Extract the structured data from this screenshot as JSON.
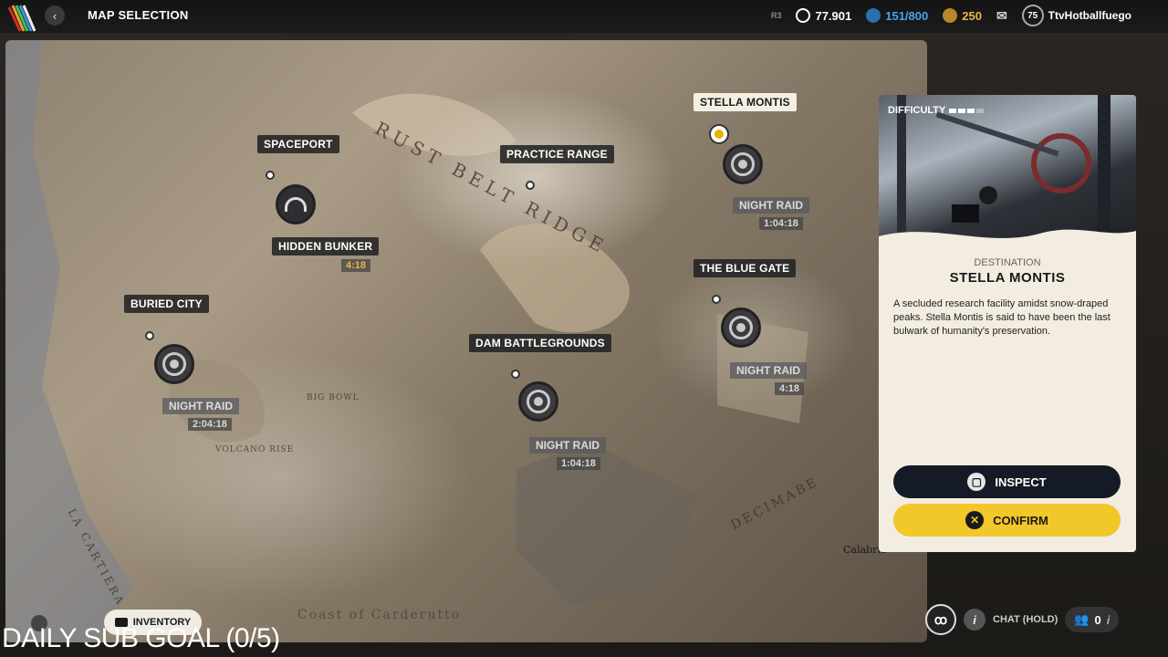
{
  "topbar": {
    "title": "MAP SELECTION",
    "back_icon": "chevron-left-icon",
    "currencies": [
      {
        "icon": "coin-icon",
        "value": "77.901",
        "color": "#ffffff"
      },
      {
        "icon": "token-icon",
        "value": "151/800",
        "color": "#4aa3e8"
      },
      {
        "icon": "gold-icon",
        "value": "250",
        "color": "#e8b64a"
      }
    ],
    "small_tag": "R3",
    "mail_icon": "mail-icon",
    "level": "75",
    "username": "TtvHotballfuego"
  },
  "map": {
    "regions": [
      "RUST BELT RIDGE",
      "DECIMABE",
      "LA CARTIERA"
    ],
    "minor_labels": [
      "BIG BOWL",
      "VOLCANO RISE",
      "Coast of Carderutto",
      "Calabria"
    ],
    "locations": [
      {
        "name": "SPACEPORT"
      },
      {
        "name": "HIDDEN BUNKER",
        "timer": "4:18"
      },
      {
        "name": "PRACTICE RANGE"
      },
      {
        "name": "STELLA MONTIS",
        "raid": "NIGHT RAID",
        "timer": "1:04:18"
      },
      {
        "name": "THE BLUE GATE",
        "raid": "NIGHT RAID",
        "timer": "4:18"
      },
      {
        "name": "BURIED CITY",
        "raid": "NIGHT RAID",
        "timer": "2:04:18"
      },
      {
        "name": "DAM BATTLEGROUNDS",
        "raid": "NIGHT RAID",
        "timer": "1:04:18"
      }
    ]
  },
  "panel": {
    "difficulty_label": "DIFFICULTY",
    "difficulty_level": 3,
    "difficulty_max": 4,
    "kicker": "DESTINATION",
    "name": "STELLA MONTIS",
    "description": "A secluded research facility amidst snow-draped peaks. Stella Montis is said to have been the last bulwark of humanity's preservation.",
    "inspect_label": "INSPECT",
    "confirm_label": "CONFIRM",
    "confirm_color": "#f2c72a"
  },
  "bottom": {
    "back_label": "BACK",
    "inventory_label": "INVENTORY",
    "chat_label": "CHAT (HOLD)",
    "party_count": "0",
    "overlay_text": "DAILY SUB GOAL (0/5)"
  }
}
